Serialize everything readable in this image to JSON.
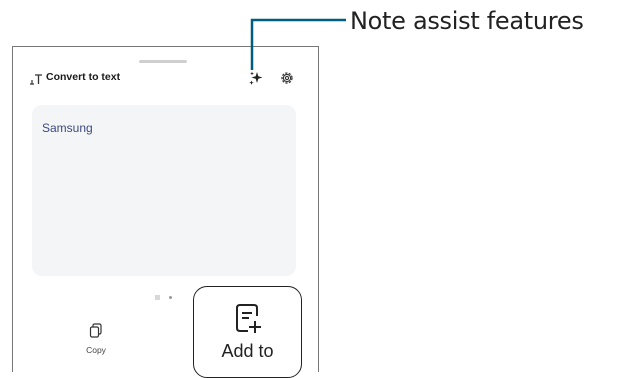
{
  "header": {
    "title": "Convert to text",
    "title_icon": "text-convert-icon",
    "assist_icon": "sparkle-icon",
    "settings_icon": "gear-icon"
  },
  "content": {
    "text": "Samsung"
  },
  "toolbar": {
    "copy_label": "Copy",
    "copy_icon": "copy-icon",
    "add_to_label": "Add to",
    "add_to_icon": "add-note-icon"
  },
  "callout": {
    "label": "Note assist features"
  },
  "colors": {
    "accent": "#005f7e",
    "text_area_bg": "#f3f5f6",
    "content_text": "#3c4a7d"
  }
}
